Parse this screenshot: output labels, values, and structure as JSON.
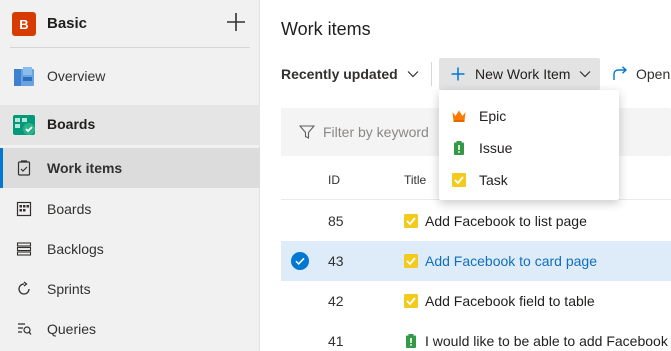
{
  "project": {
    "badge_letter": "B",
    "name": "Basic"
  },
  "sidebar": {
    "overview_label": "Overview",
    "boards_group_label": "Boards",
    "items": [
      {
        "label": "Work items",
        "selected": true
      },
      {
        "label": "Boards"
      },
      {
        "label": "Backlogs"
      },
      {
        "label": "Sprints"
      },
      {
        "label": "Queries"
      }
    ]
  },
  "main": {
    "page_title": "Work items",
    "view_selector_label": "Recently updated",
    "new_work_item_label": "New Work Item",
    "open_label": "Open",
    "filter_placeholder": "Filter by keyword",
    "columns": {
      "id": "ID",
      "title": "Title"
    },
    "rows": [
      {
        "id": "85",
        "type": "task",
        "title": "Add Facebook to list page",
        "selected": false
      },
      {
        "id": "43",
        "type": "task",
        "title": "Add Facebook to card page",
        "selected": true
      },
      {
        "id": "42",
        "type": "task",
        "title": "Add Facebook field to table",
        "selected": false
      },
      {
        "id": "41",
        "type": "issue",
        "title": "I would like to be able to add Facebook",
        "selected": false
      }
    ]
  },
  "new_item_menu": {
    "items": [
      {
        "label": "Epic",
        "icon": "crown-icon"
      },
      {
        "label": "Issue",
        "icon": "clipboard-icon"
      },
      {
        "label": "Task",
        "icon": "check-box-icon"
      }
    ]
  },
  "colors": {
    "accent": "#0078d4",
    "badge": "#d83b01",
    "epic": "#ff7b00",
    "issue": "#339947",
    "task": "#f2cb1d",
    "selected_row": "#deecf9"
  }
}
